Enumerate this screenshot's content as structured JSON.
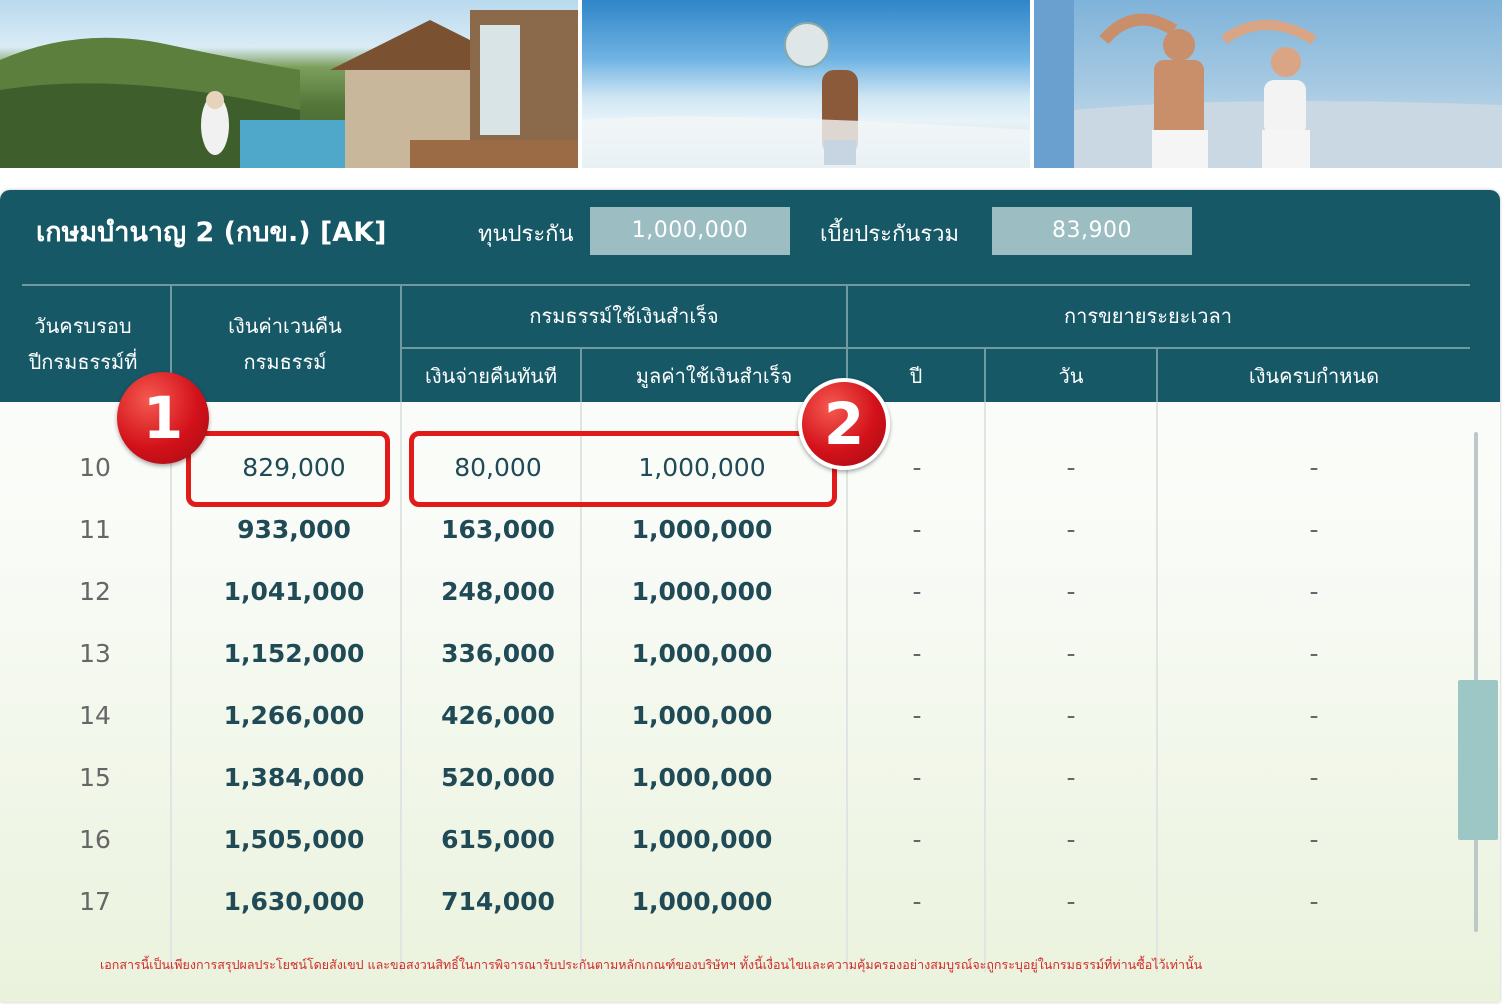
{
  "header": {
    "title": "เกษมบำนาญ 2 (กบข.) [AK]",
    "sum_insured_label": "ทุนประกัน",
    "sum_insured_value": "1,000,000",
    "total_premium_label": "เบี้ยประกันรวม",
    "total_premium_value": "83,900"
  },
  "columns": {
    "policy_year": "วันครบรอบ\nปีกรมธรรม์ที่",
    "cash_value": "เงินค่าเวนคืน\nกรมธรรม์",
    "paid_up_group": "กรมธรรม์ใช้เงินสำเร็จ",
    "immediate_pay": "เงินจ่ายคืนทันที",
    "paid_up_value": "มูลค่าใช้เงินสำเร็จ",
    "extended_group": "การขยายระยะเวลา",
    "ext_year": "ปี",
    "ext_day": "วัน",
    "ext_maturity": "เงินครบกำหนด"
  },
  "rows": [
    {
      "year": "10",
      "cash_value": "829,000",
      "immediate_pay": "80,000",
      "paid_up_value": "1,000,000",
      "ext_year": "-",
      "ext_day": "-",
      "ext_maturity": "-"
    },
    {
      "year": "11",
      "cash_value": "933,000",
      "immediate_pay": "163,000",
      "paid_up_value": "1,000,000",
      "ext_year": "-",
      "ext_day": "-",
      "ext_maturity": "-"
    },
    {
      "year": "12",
      "cash_value": "1,041,000",
      "immediate_pay": "248,000",
      "paid_up_value": "1,000,000",
      "ext_year": "-",
      "ext_day": "-",
      "ext_maturity": "-"
    },
    {
      "year": "13",
      "cash_value": "1,152,000",
      "immediate_pay": "336,000",
      "paid_up_value": "1,000,000",
      "ext_year": "-",
      "ext_day": "-",
      "ext_maturity": "-"
    },
    {
      "year": "14",
      "cash_value": "1,266,000",
      "immediate_pay": "426,000",
      "paid_up_value": "1,000,000",
      "ext_year": "-",
      "ext_day": "-",
      "ext_maturity": "-"
    },
    {
      "year": "15",
      "cash_value": "1,384,000",
      "immediate_pay": "520,000",
      "paid_up_value": "1,000,000",
      "ext_year": "-",
      "ext_day": "-",
      "ext_maturity": "-"
    },
    {
      "year": "16",
      "cash_value": "1,505,000",
      "immediate_pay": "615,000",
      "paid_up_value": "1,000,000",
      "ext_year": "-",
      "ext_day": "-",
      "ext_maturity": "-"
    },
    {
      "year": "17",
      "cash_value": "1,630,000",
      "immediate_pay": "714,000",
      "paid_up_value": "1,000,000",
      "ext_year": "-",
      "ext_day": "-",
      "ext_maturity": "-"
    }
  ],
  "footnote": "เอกสารนี้เป็นเพียงการสรุปผลประโยชน์โดยสังเขป และขอสงวนสิทธิ์ในการพิจารณารับประกันตามหลักเกณฑ์ของบริษัทฯ ทั้งนี้เงื่อนไขและความคุ้มครองอย่างสมบูรณ์จะถูกระบุอยู่ในกรมธรรม์ที่ท่านซื้อไว้เท่านั้น",
  "annotations": {
    "badge_1": "1",
    "badge_2": "2",
    "color": "#e11a1a"
  },
  "colors": {
    "header_bg": "#165866",
    "value_box": "#9cbec3",
    "value_text": "#1f4a56"
  }
}
